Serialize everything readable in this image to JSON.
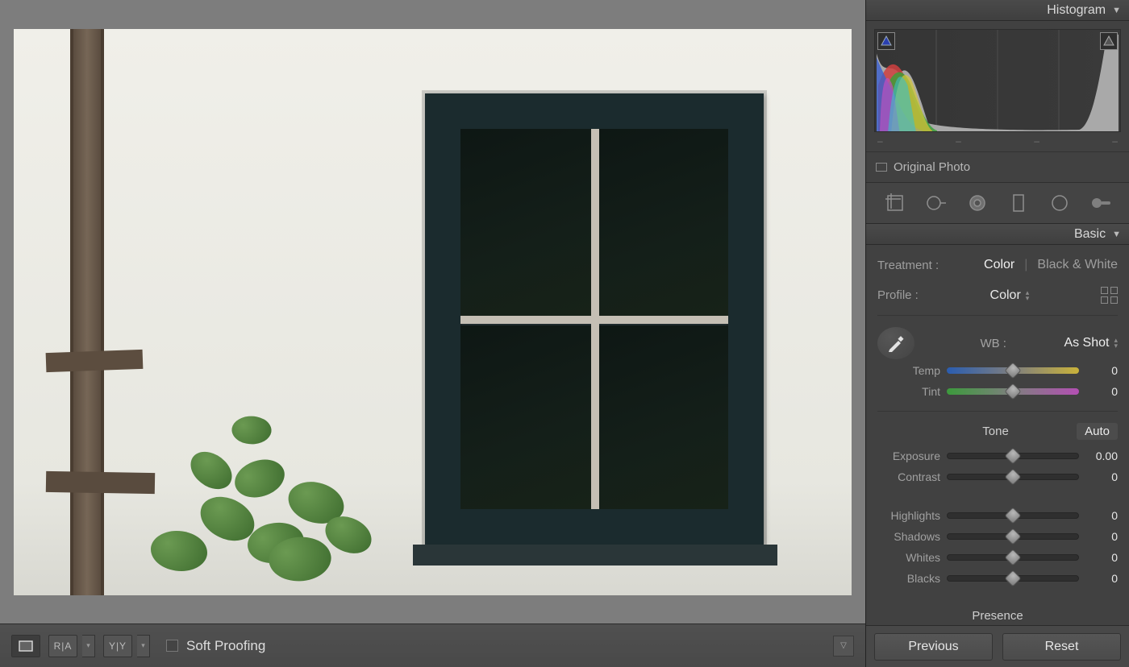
{
  "panels": {
    "histogram": {
      "title": "Histogram",
      "original_label": "Original Photo",
      "ticks": [
        "–",
        "–",
        "–",
        "–"
      ]
    },
    "basic": {
      "title": "Basic",
      "treatment_label": "Treatment :",
      "treatment_color": "Color",
      "treatment_bw": "Black & White",
      "profile_label": "Profile :",
      "profile_value": "Color",
      "wb_label": "WB :",
      "wb_value": "As Shot",
      "sliders": {
        "temp": {
          "label": "Temp",
          "value": "0"
        },
        "tint": {
          "label": "Tint",
          "value": "0"
        },
        "exposure": {
          "label": "Exposure",
          "value": "0.00"
        },
        "contrast": {
          "label": "Contrast",
          "value": "0"
        },
        "highlights": {
          "label": "Highlights",
          "value": "0"
        },
        "shadows": {
          "label": "Shadows",
          "value": "0"
        },
        "whites": {
          "label": "Whites",
          "value": "0"
        },
        "blacks": {
          "label": "Blacks",
          "value": "0"
        }
      },
      "tone_label": "Tone",
      "auto_label": "Auto",
      "presence_label": "Presence"
    }
  },
  "toolbar": {
    "soft_proofing": "Soft Proofing",
    "view_ra": "R|A",
    "view_yy": "Y|Y"
  },
  "buttons": {
    "previous": "Previous",
    "reset": "Reset"
  },
  "tools": [
    "crop",
    "spot",
    "mask",
    "rect",
    "radial",
    "brush"
  ]
}
